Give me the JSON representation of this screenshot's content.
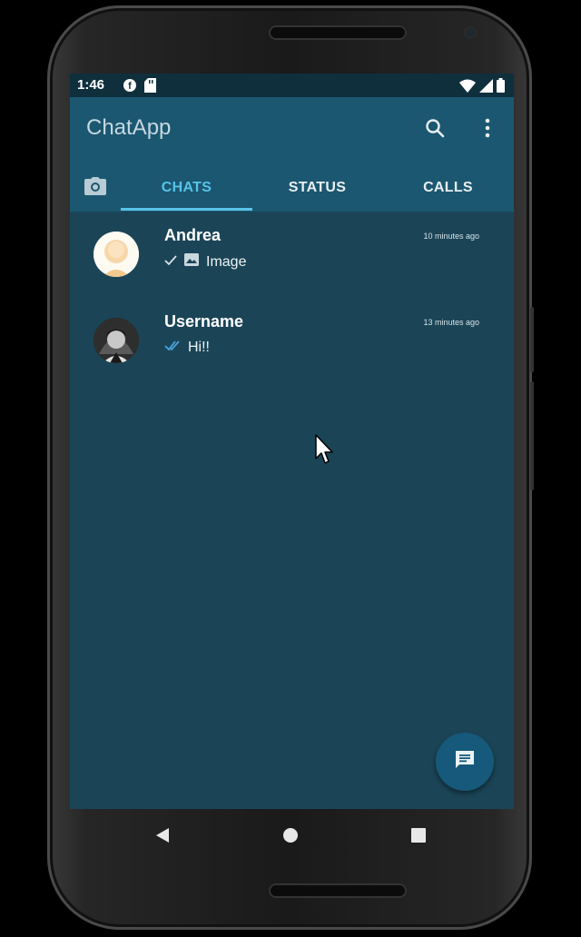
{
  "statusbar": {
    "time": "1:46",
    "left_icons": [
      "notification-app-icon",
      "sd-card-icon"
    ],
    "right_icons": [
      "wifi-icon",
      "signal-icon",
      "battery-icon"
    ]
  },
  "appbar": {
    "title": "ChatApp",
    "actions": [
      "search-icon",
      "more-vert-icon"
    ]
  },
  "tabs": {
    "camera_icon": "camera-icon",
    "items": [
      {
        "label": "CHATS",
        "active": true
      },
      {
        "label": "STATUS",
        "active": false
      },
      {
        "label": "CALLS",
        "active": false
      }
    ]
  },
  "chats": [
    {
      "name": "Andrea",
      "time": "10 minutes ago",
      "preview": "Image",
      "status_icon": "check-icon",
      "media_icon": "image-icon"
    },
    {
      "name": "Username",
      "time": "13 minutes ago",
      "preview": "Hi!!",
      "status_icon": "double-check-icon"
    }
  ],
  "fab": {
    "icon": "message-icon"
  },
  "colors": {
    "screen_bg": "#1b4557",
    "appbar_bg": "#1b5770",
    "statusbar_bg": "#0f2f3d",
    "accent": "#58c3e8",
    "fab_bg": "#16597a"
  },
  "navbar": {
    "buttons": [
      "back-icon",
      "home-icon",
      "recents-icon"
    ]
  }
}
